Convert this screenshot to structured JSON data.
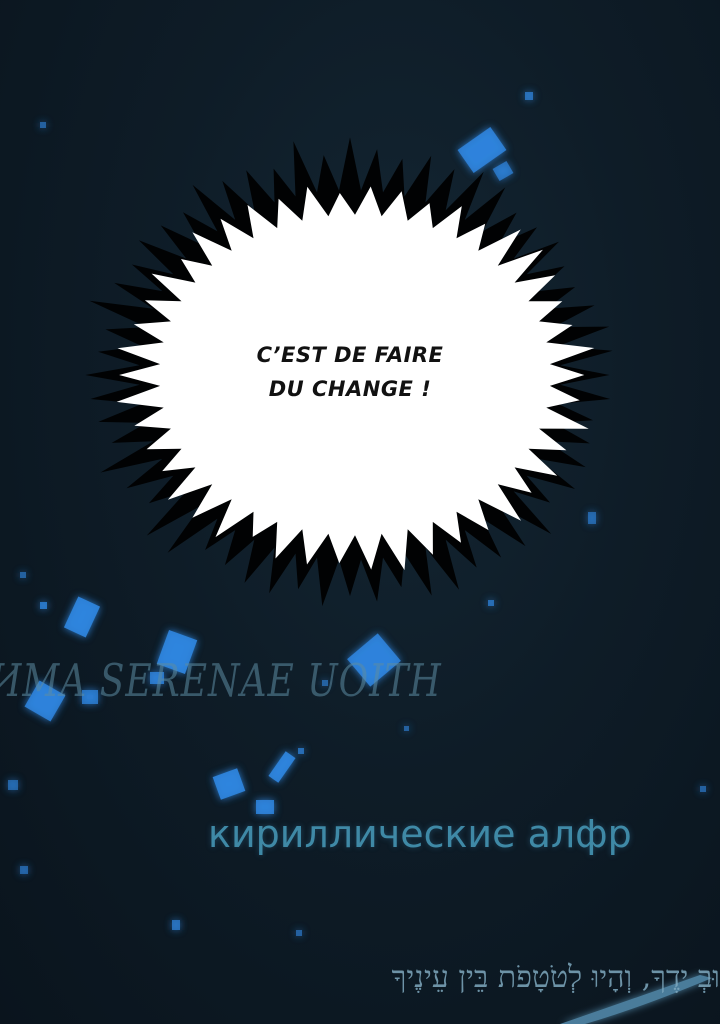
{
  "speech_bubble": {
    "line1": "C’EST DE FAIRE",
    "line2": "DU CHANGE !"
  },
  "background_texts": {
    "runic": "ИMA SERENAE UOITH",
    "cyrillic": "кириллические алфр",
    "hebrew": "וּבְ  ידֶךָ, וְהָיוּ לְטֹטָפֹת בֵּין עֵינֶיךָ"
  },
  "colors": {
    "background": "#0e1c27",
    "glow": "#2f86e0",
    "bubble_fill": "#ffffff",
    "bubble_border": "#000000"
  }
}
